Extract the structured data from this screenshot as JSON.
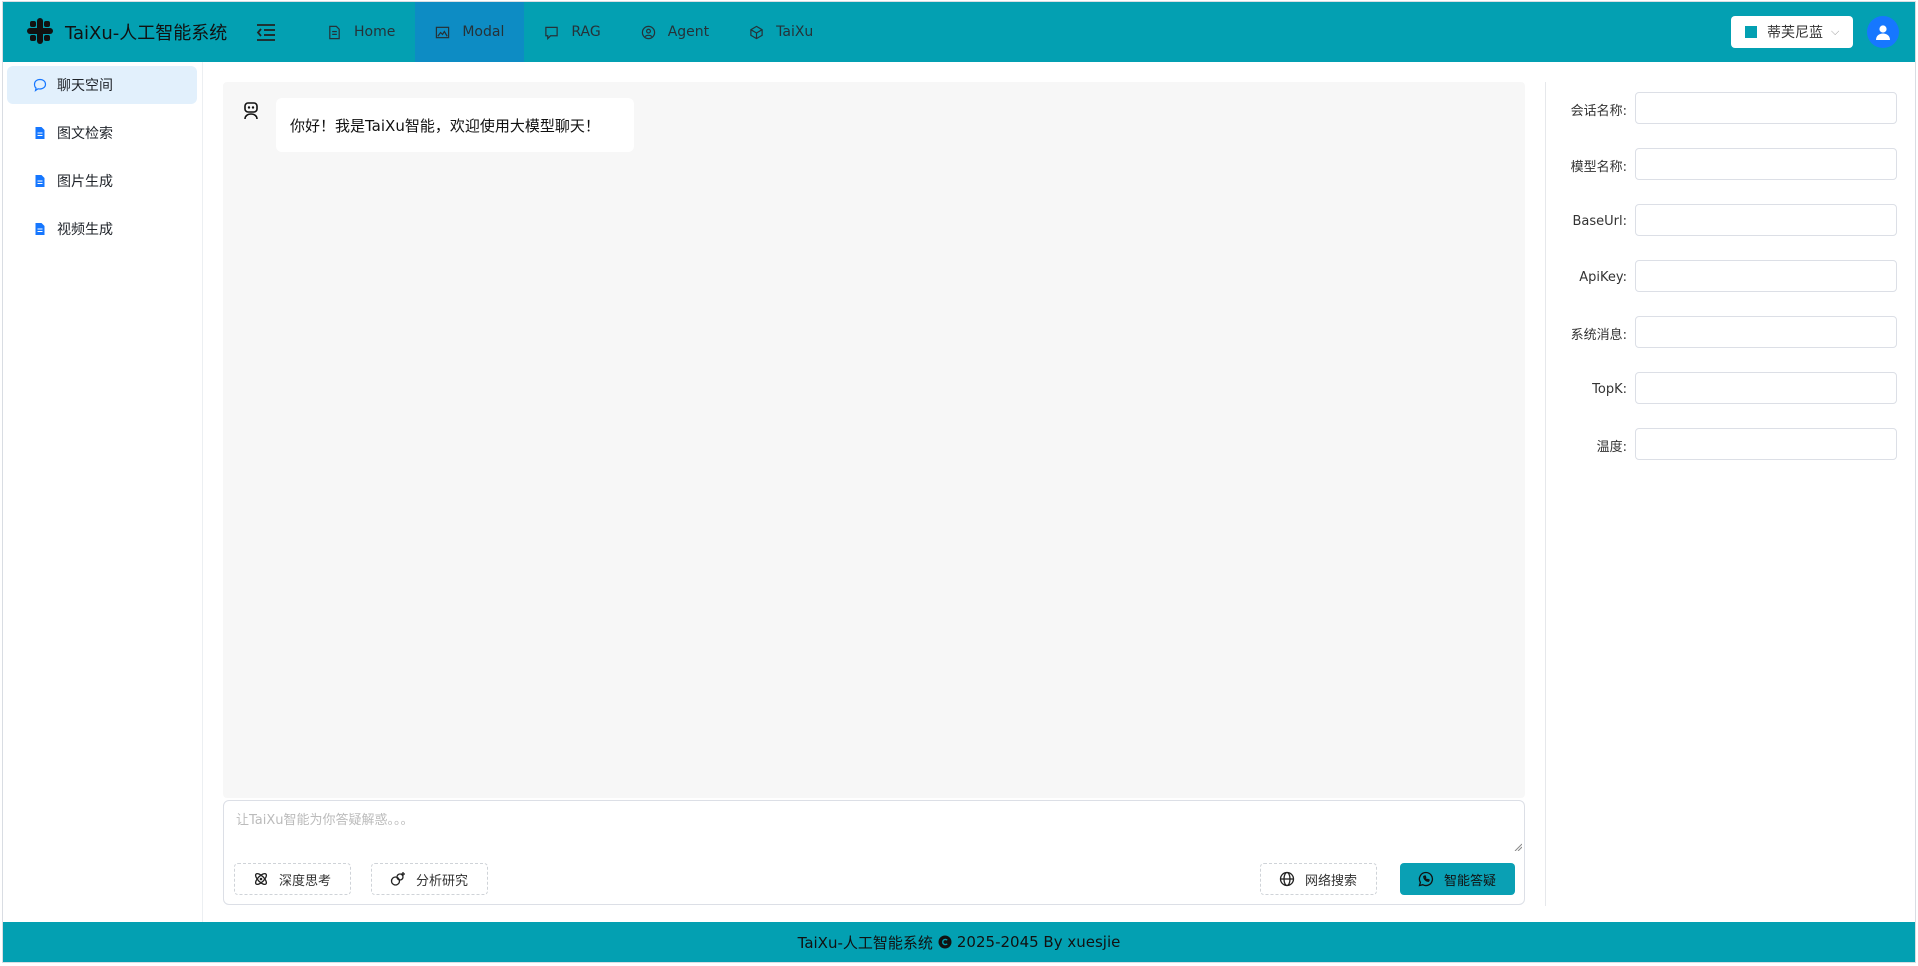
{
  "header": {
    "app_title": "TaiXu-人工智能系统",
    "nav": [
      {
        "label": "Home",
        "icon": "document-icon"
      },
      {
        "label": "Modal",
        "icon": "image-icon"
      },
      {
        "label": "RAG",
        "icon": "chat-bubble-icon"
      },
      {
        "label": "Agent",
        "icon": "user-circle-icon"
      },
      {
        "label": "TaiXu",
        "icon": "hexagon-icon"
      }
    ],
    "active_nav": "Modal",
    "theme": {
      "label": "蒂芙尼蓝",
      "color": "#03a0b2"
    }
  },
  "sidebar": {
    "items": [
      {
        "label": "聊天空间",
        "icon": "chat-icon"
      },
      {
        "label": "图文检索",
        "icon": "document-icon"
      },
      {
        "label": "图片生成",
        "icon": "document-icon"
      },
      {
        "label": "视频生成",
        "icon": "document-icon"
      }
    ],
    "active": "聊天空间"
  },
  "chat": {
    "messages": [
      {
        "role": "assistant",
        "icon": "robot-icon",
        "text": "你好！我是TaiXu智能，欢迎使用大模型聊天！"
      }
    ],
    "input_placeholder": "让TaiXu智能为你答疑解惑。。。",
    "deep_think_label": "深度思考",
    "analysis_label": "分析研究",
    "web_search_label": "网络搜索",
    "send_label": "智能答疑"
  },
  "settings_form": {
    "fields": [
      {
        "label": "会话名称:",
        "value": ""
      },
      {
        "label": "模型名称:",
        "value": ""
      },
      {
        "label": "BaseUrl:",
        "value": ""
      },
      {
        "label": "ApiKey:",
        "value": ""
      },
      {
        "label": "系统消息:",
        "value": ""
      },
      {
        "label": "TopK:",
        "value": ""
      },
      {
        "label": "温度:",
        "value": ""
      }
    ]
  },
  "footer": {
    "prefix": "TaiXu-人工智能系统",
    "suffix": "2025-2045 By xuesjie"
  },
  "colors": {
    "brand": "#03a0b2",
    "nav_active": "#0d8cc4",
    "sidebar_active": "#e2f0fc",
    "avatar": "#1677ff"
  }
}
